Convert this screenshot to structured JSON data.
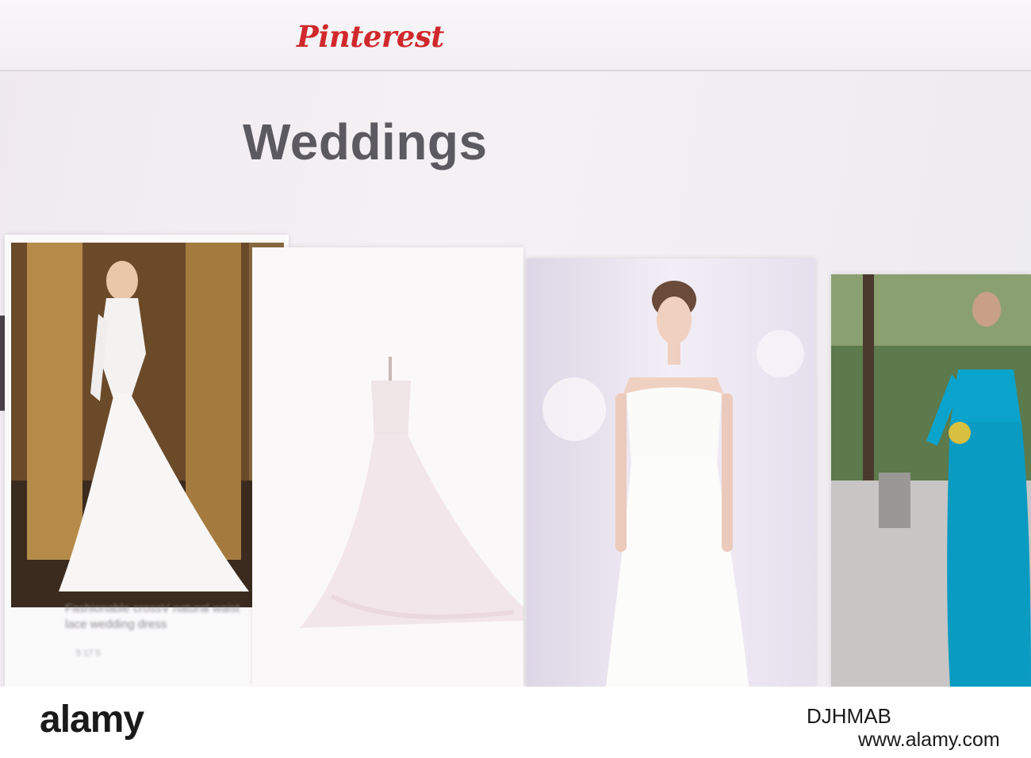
{
  "app": {
    "logo": "Pinterest"
  },
  "board": {
    "title": "Weddings"
  },
  "pins": [
    {
      "caption": "Fashionable crossV natural waist lace wedding dress",
      "meta": "5 17  5"
    },
    {
      "caption": ""
    },
    {
      "caption": ""
    },
    {
      "caption": ""
    }
  ],
  "footer": {
    "brand": "alamy",
    "stock_id": "DJHMAB",
    "url": "www.alamy.com"
  },
  "colors": {
    "logo": "#d0282c",
    "title": "#5b5a60",
    "teal_dress": "#0aa3cc"
  }
}
